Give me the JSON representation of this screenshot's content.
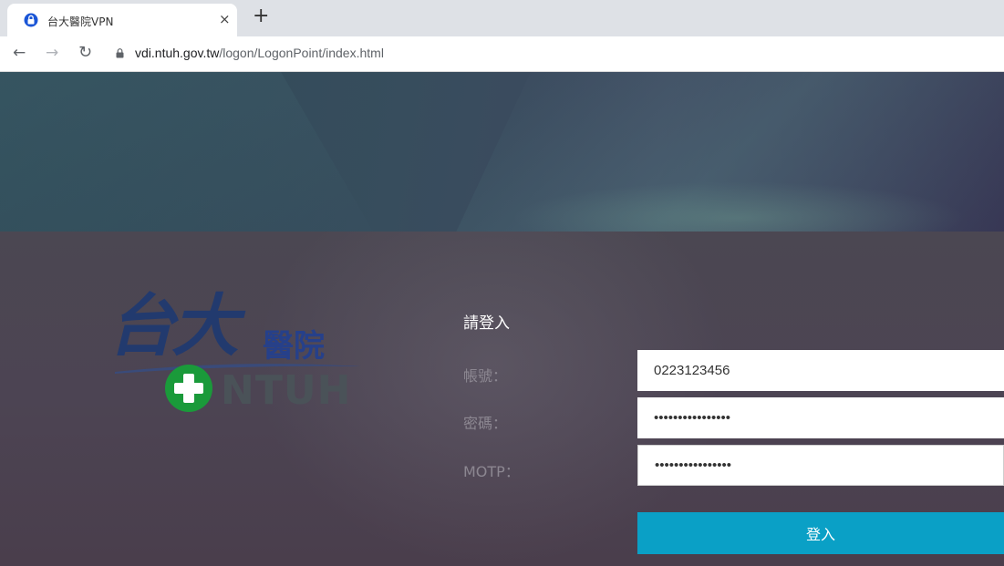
{
  "browser": {
    "tab_title": "台大醫院VPN",
    "tab_close": "×",
    "new_tab": "+",
    "url_host": "vdi.ntuh.gov.tw",
    "url_path": "/logon/LogonPoint/index.html"
  },
  "logo": {
    "chars": "台大",
    "sub": "醫院",
    "text": "NTUH"
  },
  "form": {
    "title": "請登入",
    "username_label": "帳號：",
    "username_value": "0223123456",
    "password_label": "密碼：",
    "password_value": "••••••••••••••••",
    "motp_label": "MOTP：",
    "motp_value": "••••••••••••••••",
    "login_button": "登入"
  },
  "colors": {
    "login_button": "#0aa0c6",
    "logo_blue": "#223a6e",
    "logo_green": "#1a9a3a"
  }
}
